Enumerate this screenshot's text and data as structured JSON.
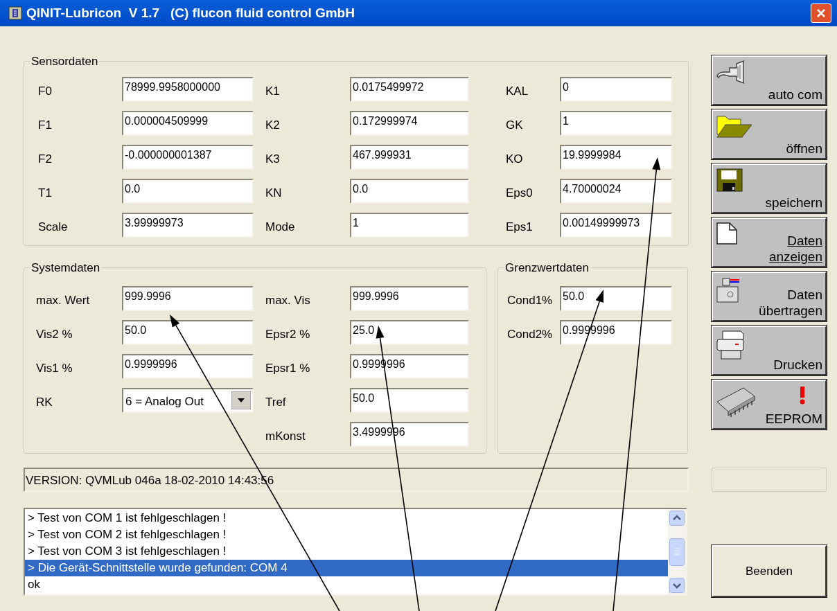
{
  "window": {
    "title": "QINIT-Lubricon  V 1.7   (C) flucon fluid control GmbH"
  },
  "sensordaten": {
    "title": "Sensordaten",
    "columns": [
      [
        {
          "label": "F0",
          "value": "78999.9958000000"
        },
        {
          "label": "F1",
          "value": "0.000004509999"
        },
        {
          "label": "F2",
          "value": "-0.000000001387"
        },
        {
          "label": "T1",
          "value": "0.0"
        },
        {
          "label": "Scale",
          "value": "3.99999973"
        }
      ],
      [
        {
          "label": "K1",
          "value": "0.0175499972"
        },
        {
          "label": "K2",
          "value": "0.172999974"
        },
        {
          "label": "K3",
          "value": "467.999931"
        },
        {
          "label": "KN",
          "value": "0.0"
        },
        {
          "label": "Mode",
          "value": "1"
        }
      ],
      [
        {
          "label": "KAL",
          "value": "0"
        },
        {
          "label": "GK",
          "value": "1"
        },
        {
          "label": "KO",
          "value": "19.9999984"
        },
        {
          "label": "Eps0",
          "value": "4.70000024"
        },
        {
          "label": "Eps1",
          "value": "0.00149999973"
        }
      ]
    ]
  },
  "systemdaten": {
    "title": "Systemdaten",
    "columns": [
      [
        {
          "kind": "text",
          "label": "max. Wert",
          "value": "999.9996"
        },
        {
          "kind": "text",
          "label": "Vis2 %",
          "value": "50.0"
        },
        {
          "kind": "text",
          "label": "Vis1 %",
          "value": "0.9999996"
        },
        {
          "kind": "combo",
          "label": "RK",
          "value": "6 = Analog Out"
        }
      ],
      [
        {
          "kind": "text",
          "label": "max. Vis",
          "value": "999.9996"
        },
        {
          "kind": "text",
          "label": "Epsr2 %",
          "value": "25.0"
        },
        {
          "kind": "text",
          "label": "Epsr1 %",
          "value": "0.9999996"
        },
        {
          "kind": "text",
          "label": "Tref",
          "value": "50.0"
        },
        {
          "kind": "text",
          "label": "mKonst",
          "value": "3.4999996"
        }
      ]
    ]
  },
  "grenzwertdaten": {
    "title": "Grenzwertdaten",
    "fields": [
      {
        "label": "Cond1%",
        "value": "50.0"
      },
      {
        "label": "Cond2%",
        "value": "0.9999996"
      }
    ]
  },
  "version_field": {
    "value": "VERSION: QVMLub 046a 18-02-2010 14:43:56"
  },
  "log": [
    {
      "text": "> Test von COM 1 ist fehlgeschlagen !",
      "selected": false
    },
    {
      "text": "> Test von COM 2 ist fehlgeschlagen !",
      "selected": false
    },
    {
      "text": "> Test von COM 3 ist fehlgeschlagen !",
      "selected": false
    },
    {
      "text": "> Die Gerät-Schnittstelle wurde gefunden: COM 4",
      "selected": true
    },
    {
      "text": "ok",
      "selected": false
    }
  ],
  "toolbar": [
    {
      "kind": "plug",
      "label": "auto com",
      "underlined": false
    },
    {
      "kind": "folder",
      "label": "öffnen",
      "underlined": false
    },
    {
      "kind": "disk",
      "label": "speichern",
      "underlined": false
    },
    {
      "kind": "page",
      "label": "Daten anzeigen",
      "underlined": true
    },
    {
      "kind": "transfer",
      "label": "Daten übertragen",
      "underlined": false
    },
    {
      "kind": "printer",
      "label": "Drucken",
      "underlined": false
    },
    {
      "kind": "chip",
      "label": "EEPROM",
      "underlined": false
    }
  ],
  "exit_button": {
    "label": "Beenden"
  }
}
